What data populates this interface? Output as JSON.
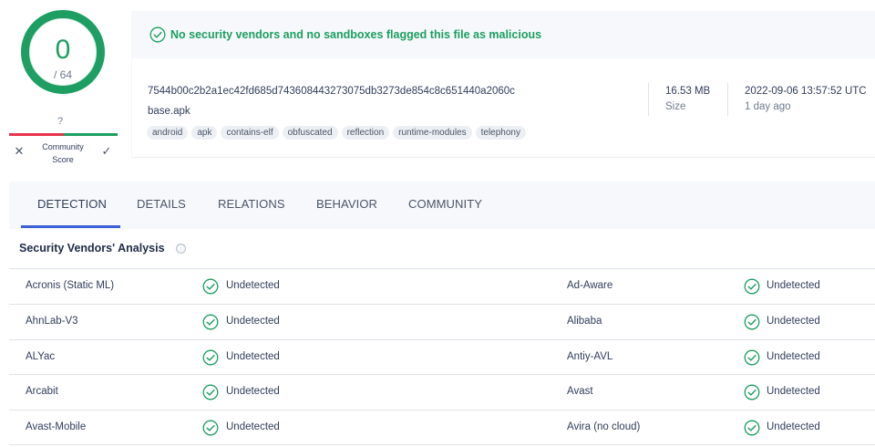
{
  "score": {
    "detections": "0",
    "total": "/ 64"
  },
  "community": {
    "question": "?",
    "label_line1": "Community",
    "label_line2": "Score",
    "vote_down": "✕",
    "vote_up": "✓"
  },
  "banner": {
    "message": "No security vendors and no sandboxes flagged this file as malicious",
    "accent": "#1d9e62"
  },
  "file": {
    "hash": "7544b00c2b2a1ec42fd685d743608443273075db3273de854c8c651440a2060c",
    "name": "base.apk",
    "tags": [
      "android",
      "apk",
      "contains-elf",
      "obfuscated",
      "reflection",
      "runtime-modules",
      "telephony"
    ],
    "size_value": "16.53 MB",
    "size_label": "Size",
    "date_value": "2022-09-06 13:57:52 UTC",
    "date_label": "1 day ago"
  },
  "tabs": [
    {
      "label": "DETECTION",
      "active": true
    },
    {
      "label": "DETAILS",
      "active": false
    },
    {
      "label": "RELATIONS",
      "active": false
    },
    {
      "label": "BEHAVIOR",
      "active": false
    },
    {
      "label": "COMMUNITY",
      "active": false
    }
  ],
  "analysis": {
    "title": "Security Vendors' Analysis",
    "info_icon": "ⓘ",
    "rows": [
      {
        "left_vendor": "Acronis (Static ML)",
        "left_result": "Undetected",
        "right_vendor": "Ad-Aware",
        "right_result": "Undetected"
      },
      {
        "left_vendor": "AhnLab-V3",
        "left_result": "Undetected",
        "right_vendor": "Alibaba",
        "right_result": "Undetected"
      },
      {
        "left_vendor": "ALYac",
        "left_result": "Undetected",
        "right_vendor": "Antiy-AVL",
        "right_result": "Undetected"
      },
      {
        "left_vendor": "Arcabit",
        "left_result": "Undetected",
        "right_vendor": "Avast",
        "right_result": "Undetected"
      },
      {
        "left_vendor": "Avast-Mobile",
        "left_result": "Undetected",
        "right_vendor": "Avira (no cloud)",
        "right_result": "Undetected"
      }
    ]
  },
  "colors": {
    "clean": "#1d9e62",
    "malicious": "#e8344d",
    "tab_active": "#3c5ed6"
  }
}
